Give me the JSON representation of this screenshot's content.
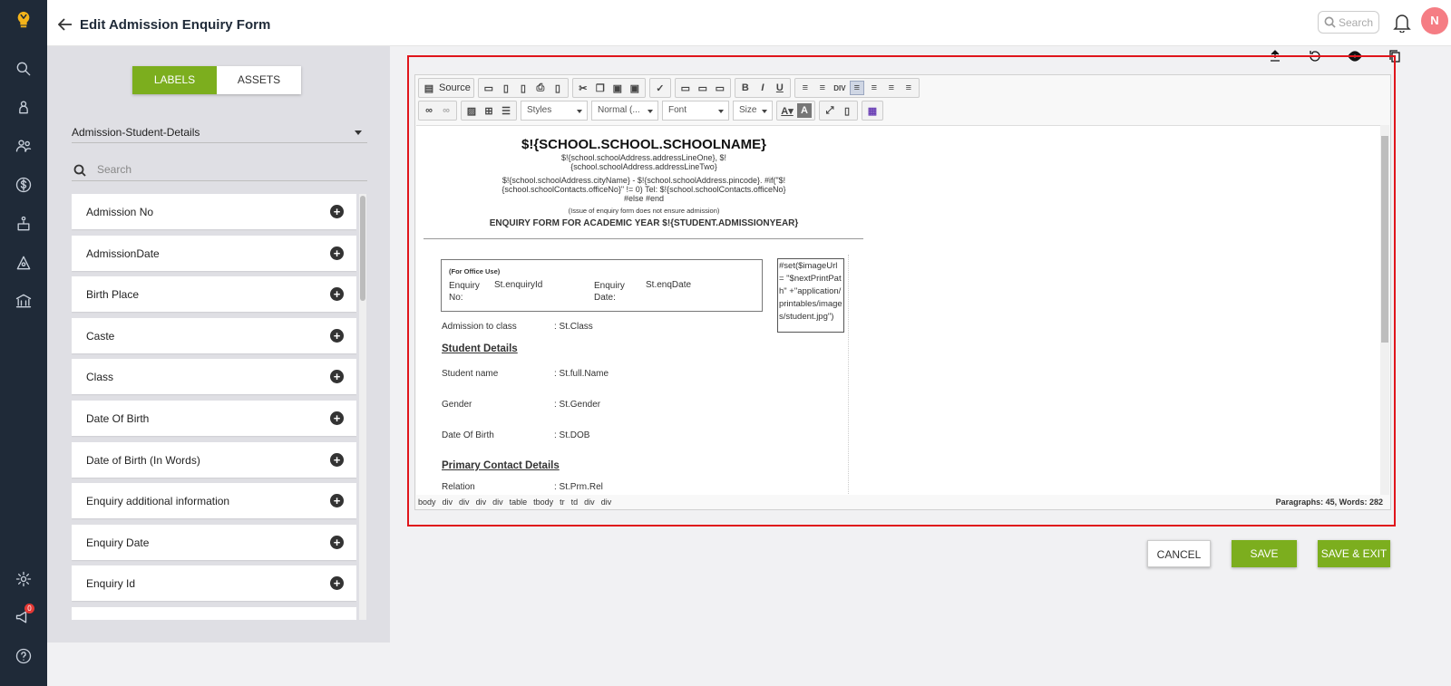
{
  "header": {
    "title": "Edit Admission Enquiry Form",
    "search_placeholder": "Search",
    "avatar_initial": "N",
    "notification_count": "0"
  },
  "tabs": {
    "labels": "LABELS",
    "assets": "ASSETS"
  },
  "category": {
    "selected": "Admission-Student-Details"
  },
  "label_search": {
    "placeholder": "Search"
  },
  "labels": [
    "Admission No",
    "AdmissionDate",
    "Birth Place",
    "Caste",
    "Class",
    "Date Of Birth",
    "Date of Birth (In Words)",
    "Enquiry additional information",
    "Enquiry Date",
    "Enquiry Id"
  ],
  "toolbar": {
    "source": "Source",
    "styles": "Styles",
    "format": "Normal (...",
    "font": "Font",
    "size": "Size"
  },
  "document": {
    "school_name": "$!{SCHOOL.SCHOOL.SCHOOLNAME}",
    "address1": "$!{school.schoolAddress.addressLineOne},  $!",
    "address2": "{school.schoolAddress.addressLineTwo}",
    "address3": "$!{school.schoolAddress.cityName} - $!{school.schoolAddress.pincode}. #if(\"$!",
    "address4": "{school.schoolContacts.officeNo}\" != 0) Tel: $!{school.schoolContacts.officeNo}",
    "address5": "#else   #end",
    "note": "(Issue of enquiry form does not ensure admission)",
    "form_title": "ENQUIRY FORM FOR ACADEMIC YEAR $!{STUDENT.ADMISSIONYEAR}",
    "office_use": "(For Office Use)",
    "enquiry_no_label": "Enquiry No:",
    "enquiry_no_value": "St.enquiryId",
    "enquiry_date_label": "Enquiry Date:",
    "enquiry_date_value": "St.enqDate",
    "image_macro": "#set($imageUrl = \"$nextPrintPath\" +\"application/printables/images/student.jpg\")",
    "admission_class_label": "Admission to class",
    "admission_class_value": ": St.Class",
    "student_details": "Student Details",
    "student_name_label": "Student name",
    "student_name_value": ": St.full.Name",
    "gender_label": "Gender",
    "gender_value": ": St.Gender",
    "dob_label": "Date Of Birth",
    "dob_value": ": St.DOB",
    "primary_contact": "Primary Contact Details",
    "relation_label": "Relation",
    "relation_value": ": St.Prm.Rel"
  },
  "statusbar": {
    "path": [
      "body",
      "div",
      "div",
      "div",
      "div",
      "table",
      "tbody",
      "tr",
      "td",
      "div",
      "div"
    ],
    "count": "Paragraphs: 45, Words: 282"
  },
  "buttons": {
    "cancel": "CANCEL",
    "save": "SAVE",
    "save_exit": "SAVE & EXIT"
  },
  "colors": {
    "accent": "#7cae1e",
    "highlight": "#e0151b",
    "rail": "#1f2a38"
  }
}
